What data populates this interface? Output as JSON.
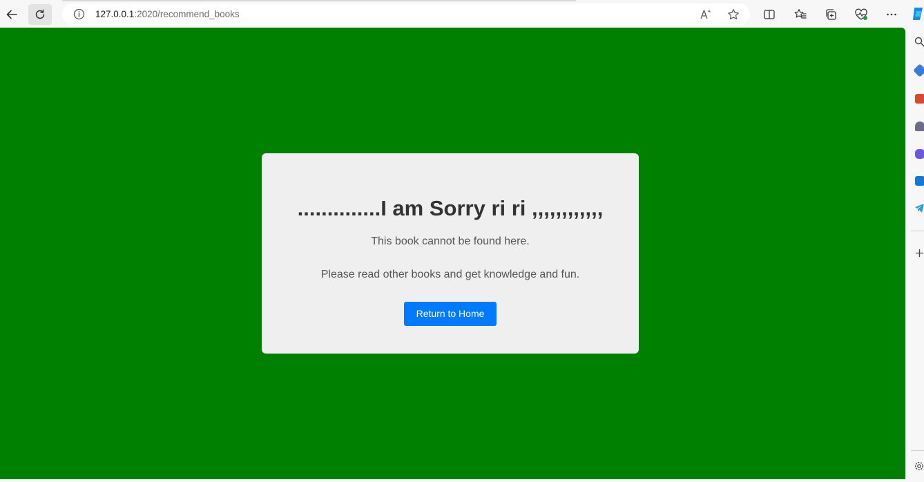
{
  "browser": {
    "url_host": "127.0.0.1",
    "url_rest": ":2020/recommend_books",
    "icons": {
      "back": "back-arrow-icon",
      "refresh": "refresh-icon",
      "site_info": "info-icon",
      "read_aloud": "read-aloud-icon",
      "favorite": "star-icon",
      "split_screen": "split-screen-icon",
      "favorites": "favorites-list-icon",
      "collections": "collections-icon",
      "browser_essentials": "heart-pulse-icon",
      "more": "more-dots-icon"
    }
  },
  "sidebar": {
    "icons": [
      "copilot-icon",
      "search-icon",
      "shopping-tag-icon",
      "tools-briefcase-icon",
      "games-person-icon",
      "microsoft-365-icon",
      "outlook-icon",
      "telegram-icon",
      "add-icon",
      "settings-gear-icon"
    ]
  },
  "page": {
    "background_color": "#008000",
    "heading": "..............I am Sorry ri ri ,,,,,,,,,,,,",
    "line1": "This book cannot be found here.",
    "line2": "Please read other books and get knowledge and fun.",
    "button_label": "Return to Home",
    "button_color": "#007bff"
  }
}
